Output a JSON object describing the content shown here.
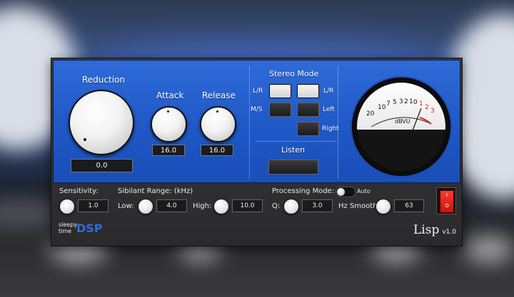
{
  "plugin": {
    "reduction": {
      "label": "Reduction",
      "value": "0.0"
    },
    "attack": {
      "label": "Attack",
      "value": "16.0"
    },
    "release": {
      "label": "Release",
      "value": "16.0"
    },
    "stereo_mode": {
      "title": "Stereo Mode",
      "lr_left": "L/R",
      "ms": "M/S",
      "lr_right": "L/R",
      "left": "Left",
      "right": "Right"
    },
    "listen_label": "Listen",
    "meter": {
      "unit": "dBVU",
      "scale_black": [
        "20",
        "10",
        "7",
        "5",
        "3",
        "2",
        "1",
        "0"
      ],
      "scale_red": [
        "1",
        "2",
        "3"
      ]
    }
  },
  "bottom": {
    "sensitivity": {
      "label": "Sensitivity:",
      "value": "1.0"
    },
    "sibilant_range": {
      "label": "Sibilant Range: (kHz)",
      "low_label": "Low:",
      "low_value": "4.0",
      "high_label": "High:",
      "high_value": "10.0"
    },
    "processing_mode": {
      "label": "Processing Mode:",
      "auto_label": "Auto"
    },
    "q": {
      "label": "Q:",
      "value": "3.0"
    },
    "hz_smooth": {
      "label": "Hz Smooth:",
      "value": "63"
    },
    "power": {
      "on": "I",
      "off": "O"
    }
  },
  "logo": {
    "line1": "sleepy",
    "line2": "time",
    "brand": "DSP"
  },
  "product": {
    "name": "Lisp",
    "version": "v1.0"
  },
  "colors": {
    "panel_blue": "#1f58c7",
    "meter_red": "#d8281e",
    "logo_blue": "#2f6be0",
    "power_red": "#e0241a"
  }
}
